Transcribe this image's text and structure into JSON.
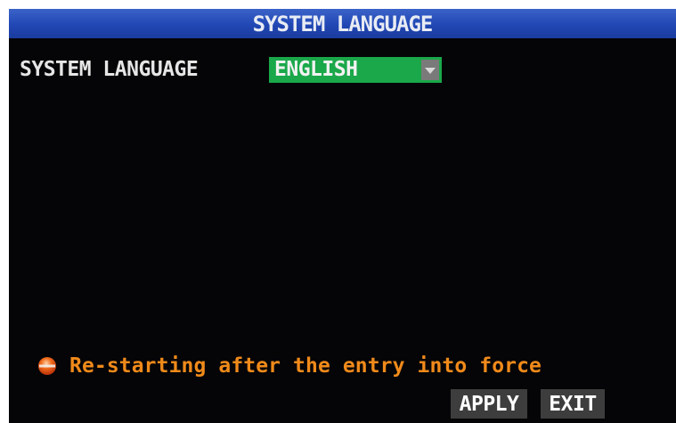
{
  "window": {
    "title": "SYSTEM LANGUAGE"
  },
  "settings": {
    "language_label": "SYSTEM LANGUAGE",
    "language_value": "ENGLISH"
  },
  "notice": {
    "icon": "warning-dot-icon",
    "text": "Re-starting after the entry into force"
  },
  "buttons": {
    "apply": "APPLY",
    "exit": "EXIT"
  },
  "colors": {
    "title_bar": "#2147b4",
    "background": "#050507",
    "select_bg": "#1aa84a",
    "notice_text": "#f08a1a",
    "button_bg": "#3d3d3d"
  }
}
